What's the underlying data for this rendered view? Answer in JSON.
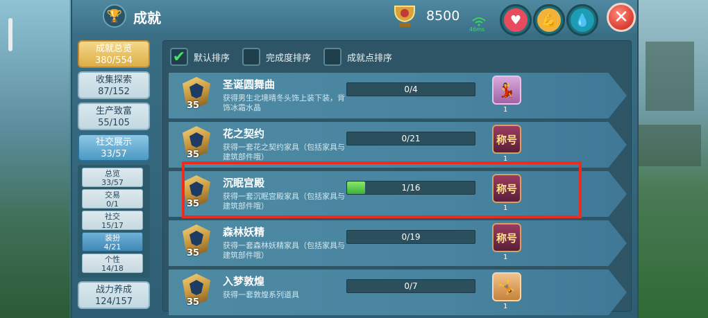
{
  "header": {
    "title": "成就",
    "points": "8500",
    "ping": "46ms"
  },
  "sidebar": {
    "categories": [
      {
        "label": "成就总览",
        "value": "380/554"
      },
      {
        "label": "收集探索",
        "value": "87/152"
      },
      {
        "label": "生产致富",
        "value": "55/105"
      },
      {
        "label": "社交展示",
        "value": "33/57"
      }
    ],
    "subcategories": [
      {
        "label": "总览",
        "value": "33/57"
      },
      {
        "label": "交易",
        "value": "0/1"
      },
      {
        "label": "社交",
        "value": "15/17"
      },
      {
        "label": "装扮",
        "value": "4/21"
      },
      {
        "label": "个性",
        "value": "14/18"
      }
    ],
    "last_category": {
      "label": "战力养成",
      "value": "124/157"
    }
  },
  "sort": {
    "default": "默认排序",
    "completion": "完成度排序",
    "points": "成就点排序"
  },
  "achievements": [
    {
      "title": "圣诞圆舞曲",
      "level": "35",
      "desc": "获得男生北境晴冬头饰上装下装，背饰冰霜水晶",
      "progress": "0/4",
      "fraction": 0.0,
      "reward_icon": "dance-icon",
      "reward_count": "1"
    },
    {
      "title": "花之契约",
      "level": "35",
      "desc": "获得一套花之契约家具（包括家具与建筑部件哦）",
      "progress": "0/21",
      "fraction": 0.0,
      "reward_icon": "title-badge",
      "reward_label": "称号",
      "reward_count": "1"
    },
    {
      "title": "沉眠宫殿",
      "level": "35",
      "desc": "获得一套沉眠宫殿家具（包括家具与建筑部件哦）",
      "progress": "1/16",
      "fraction": 0.0625,
      "reward_icon": "title-badge",
      "reward_label": "称号",
      "reward_count": "1"
    },
    {
      "title": "森林妖精",
      "level": "35",
      "desc": "获得一套森林妖精家具（包括家具与建筑部件哦）",
      "progress": "0/19",
      "fraction": 0.0,
      "reward_icon": "title-badge",
      "reward_label": "称号",
      "reward_count": "1"
    },
    {
      "title": "入梦敦煌",
      "level": "35",
      "desc": "获得一套敦煌系列道具",
      "progress": "0/7",
      "fraction": 0.0,
      "reward_icon": "dance-icon",
      "reward_count": "1"
    }
  ]
}
